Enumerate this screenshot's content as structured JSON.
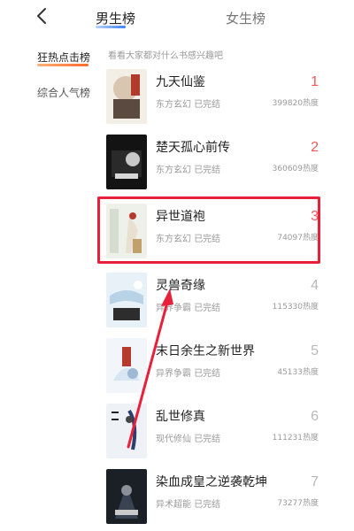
{
  "header": {
    "tabs": [
      {
        "label": "男生榜",
        "active": true
      },
      {
        "label": "女生榜",
        "active": false
      }
    ]
  },
  "sidebar": {
    "items": [
      {
        "label": "狂热点击榜",
        "active": true
      },
      {
        "label": "综合人气榜",
        "active": false
      }
    ]
  },
  "main": {
    "subtitle": "看看大家都对什么书感兴趣吧",
    "books": [
      {
        "rank": "1",
        "title": "九天仙鉴",
        "genre": "东方玄幻",
        "status": "已完结",
        "heat": "399820热度"
      },
      {
        "rank": "2",
        "title": "楚天孤心前传",
        "genre": "东方玄幻",
        "status": "已完结",
        "heat": "360609热度"
      },
      {
        "rank": "3",
        "title": "异世道袍",
        "genre": "东方玄幻",
        "status": "已完结",
        "heat": "74097热度"
      },
      {
        "rank": "4",
        "title": "灵兽奇缘",
        "genre": "异界争霸",
        "status": "已完结",
        "heat": "115330热度"
      },
      {
        "rank": "5",
        "title": "末日余生之新世界",
        "genre": "异界争霸",
        "status": "已完结",
        "heat": "45133热度"
      },
      {
        "rank": "6",
        "title": "乱世修真",
        "genre": "现代修仙",
        "status": "已完结",
        "heat": "111231热度"
      },
      {
        "rank": "7",
        "title": "染血成皇之逆袭乾坤",
        "genre": "异术超能",
        "status": "已完结",
        "heat": "73277热度"
      }
    ]
  },
  "colors": {
    "rank_top": "#f05a5a",
    "rank_other": "#b9b9b9",
    "highlight": "#e9203a"
  },
  "icons": {
    "back": "chevron-left-icon"
  }
}
